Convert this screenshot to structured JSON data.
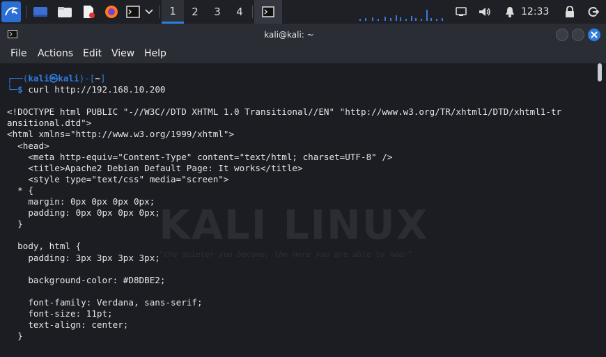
{
  "panel": {
    "workspaces": [
      "1",
      "2",
      "3",
      "4"
    ],
    "active_workspace": "1",
    "clock": "12:33",
    "icons": [
      "kali-menu-icon",
      "desktop-icon",
      "file-manager-icon",
      "text-editor-icon",
      "firefox-icon",
      "terminal-icon",
      "volume-icon",
      "notifications-icon",
      "lock-icon",
      "logout-icon"
    ]
  },
  "window": {
    "title": "kali@kali: ~",
    "menu": [
      "File",
      "Actions",
      "Edit",
      "View",
      "Help"
    ]
  },
  "terminal": {
    "prompt_user": "kali㉿kali",
    "prompt_dir": "~",
    "command": "curl http://192.168.10.200",
    "output": [
      "<!DOCTYPE html PUBLIC \"-//W3C//DTD XHTML 1.0 Transitional//EN\" \"http://www.w3.org/TR/xhtml1/DTD/xhtml1-tr",
      "ansitional.dtd\">",
      "<html xmlns=\"http://www.w3.org/1999/xhtml\">",
      "  <head>",
      "    <meta http-equiv=\"Content-Type\" content=\"text/html; charset=UTF-8\" />",
      "    <title>Apache2 Debian Default Page: It works</title>",
      "    <style type=\"text/css\" media=\"screen\">",
      "  * {",
      "    margin: 0px 0px 0px 0px;",
      "    padding: 0px 0px 0px 0px;",
      "  }",
      "",
      "  body, html {",
      "    padding: 3px 3px 3px 3px;",
      "",
      "    background-color: #D8DBE2;",
      "",
      "    font-family: Verdana, sans-serif;",
      "    font-size: 11pt;",
      "    text-align: center;",
      "  }"
    ]
  },
  "watermark": {
    "title": "KALI LINUX",
    "tagline": "\"the quieter you become, the more you are able to hear\""
  },
  "colors": {
    "accent": "#2f7de1",
    "background": "#1b1d22",
    "panel": "#1e2026"
  }
}
